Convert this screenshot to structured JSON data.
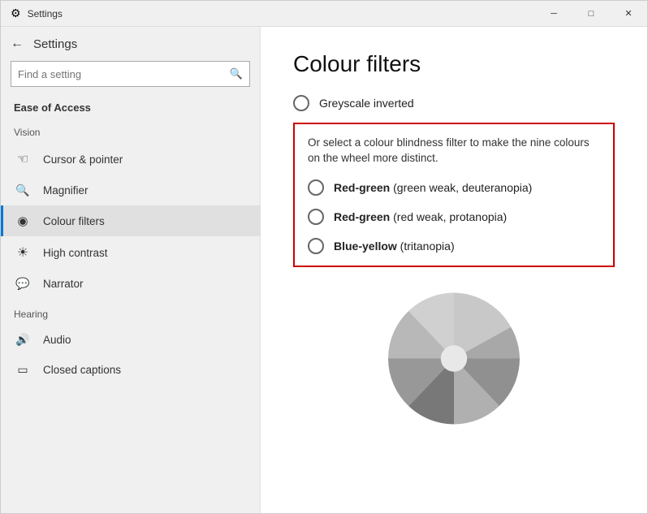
{
  "titleBar": {
    "title": "Settings",
    "minimizeLabel": "─",
    "maximizeLabel": "□",
    "closeLabel": "✕"
  },
  "sidebar": {
    "backIcon": "←",
    "appTitle": "Settings",
    "search": {
      "placeholder": "Find a setting",
      "icon": "🔍"
    },
    "categoryLabel": "Ease of Access",
    "sections": [
      {
        "label": "Vision",
        "items": [
          {
            "id": "cursor",
            "icon": "☞",
            "label": "Cursor & pointer"
          },
          {
            "id": "magnifier",
            "icon": "🔍",
            "label": "Magnifier"
          },
          {
            "id": "colour-filters",
            "icon": "⊙",
            "label": "Colour filters",
            "active": true
          },
          {
            "id": "high-contrast",
            "icon": "☀",
            "label": "High contrast"
          },
          {
            "id": "narrator",
            "icon": "💬",
            "label": "Narrator"
          }
        ]
      },
      {
        "label": "Hearing",
        "items": [
          {
            "id": "audio",
            "icon": "🔊",
            "label": "Audio"
          },
          {
            "id": "closed-captions",
            "icon": "⊡",
            "label": "Closed captions"
          }
        ]
      }
    ]
  },
  "content": {
    "pageTitle": "Colour filters",
    "greyscaleInverted": {
      "label": "Greyscale inverted"
    },
    "filterBox": {
      "description": "Or select a colour blindness filter to make the nine colours on the wheel more distinct.",
      "options": [
        {
          "id": "red-green-weak",
          "boldPart": "Red-green",
          "rest": " (green weak, deuteranopia)"
        },
        {
          "id": "red-green-protanopia",
          "boldPart": "Red-green",
          "rest": " (red weak, protanopia)"
        },
        {
          "id": "blue-yellow",
          "boldPart": "Blue-yellow",
          "rest": " (tritanopia)"
        }
      ]
    }
  }
}
